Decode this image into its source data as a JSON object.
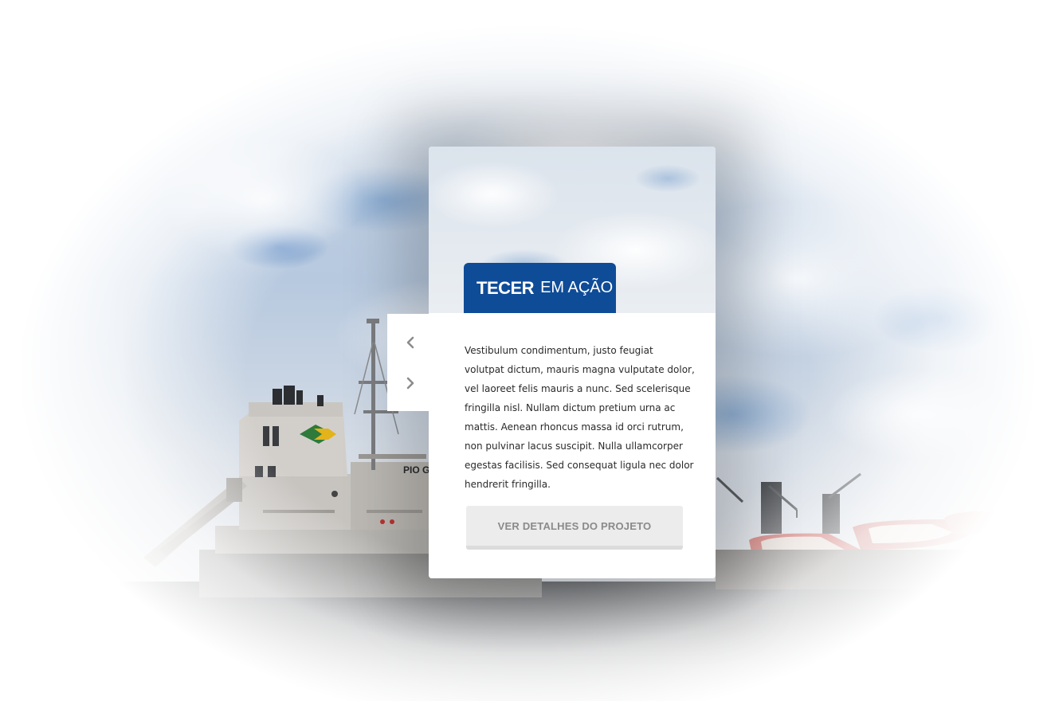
{
  "card": {
    "tag_brand": "TECER",
    "tag_sub": "EM AÇÃO",
    "body_text": "Vestibulum condimentum, justo feugiat volutpat dictum, mauris magna vulputate dolor, vel laoreet felis mauris a nunc. Sed scelerisque fringilla nisl. Nullam dictum pretium urna ac mattis. Aenean rhoncus massa id orci rutrum, non pulvinar lacus suscipit. Nulla ullamcorper egestas facilisis. Sed consequat ligula nec dolor hendrerit fringilla.",
    "button_label": "VER DETALHES DO PROJETO"
  },
  "navigation": {
    "prev_icon": "chevron-left-icon",
    "next_icon": "chevron-right-icon"
  },
  "ship_marking": "PIO G",
  "colors": {
    "brand_blue": "#0f4c97",
    "button_bg": "#ececec",
    "button_text": "#8a8a8a",
    "arrow": "#8c8c8c"
  }
}
